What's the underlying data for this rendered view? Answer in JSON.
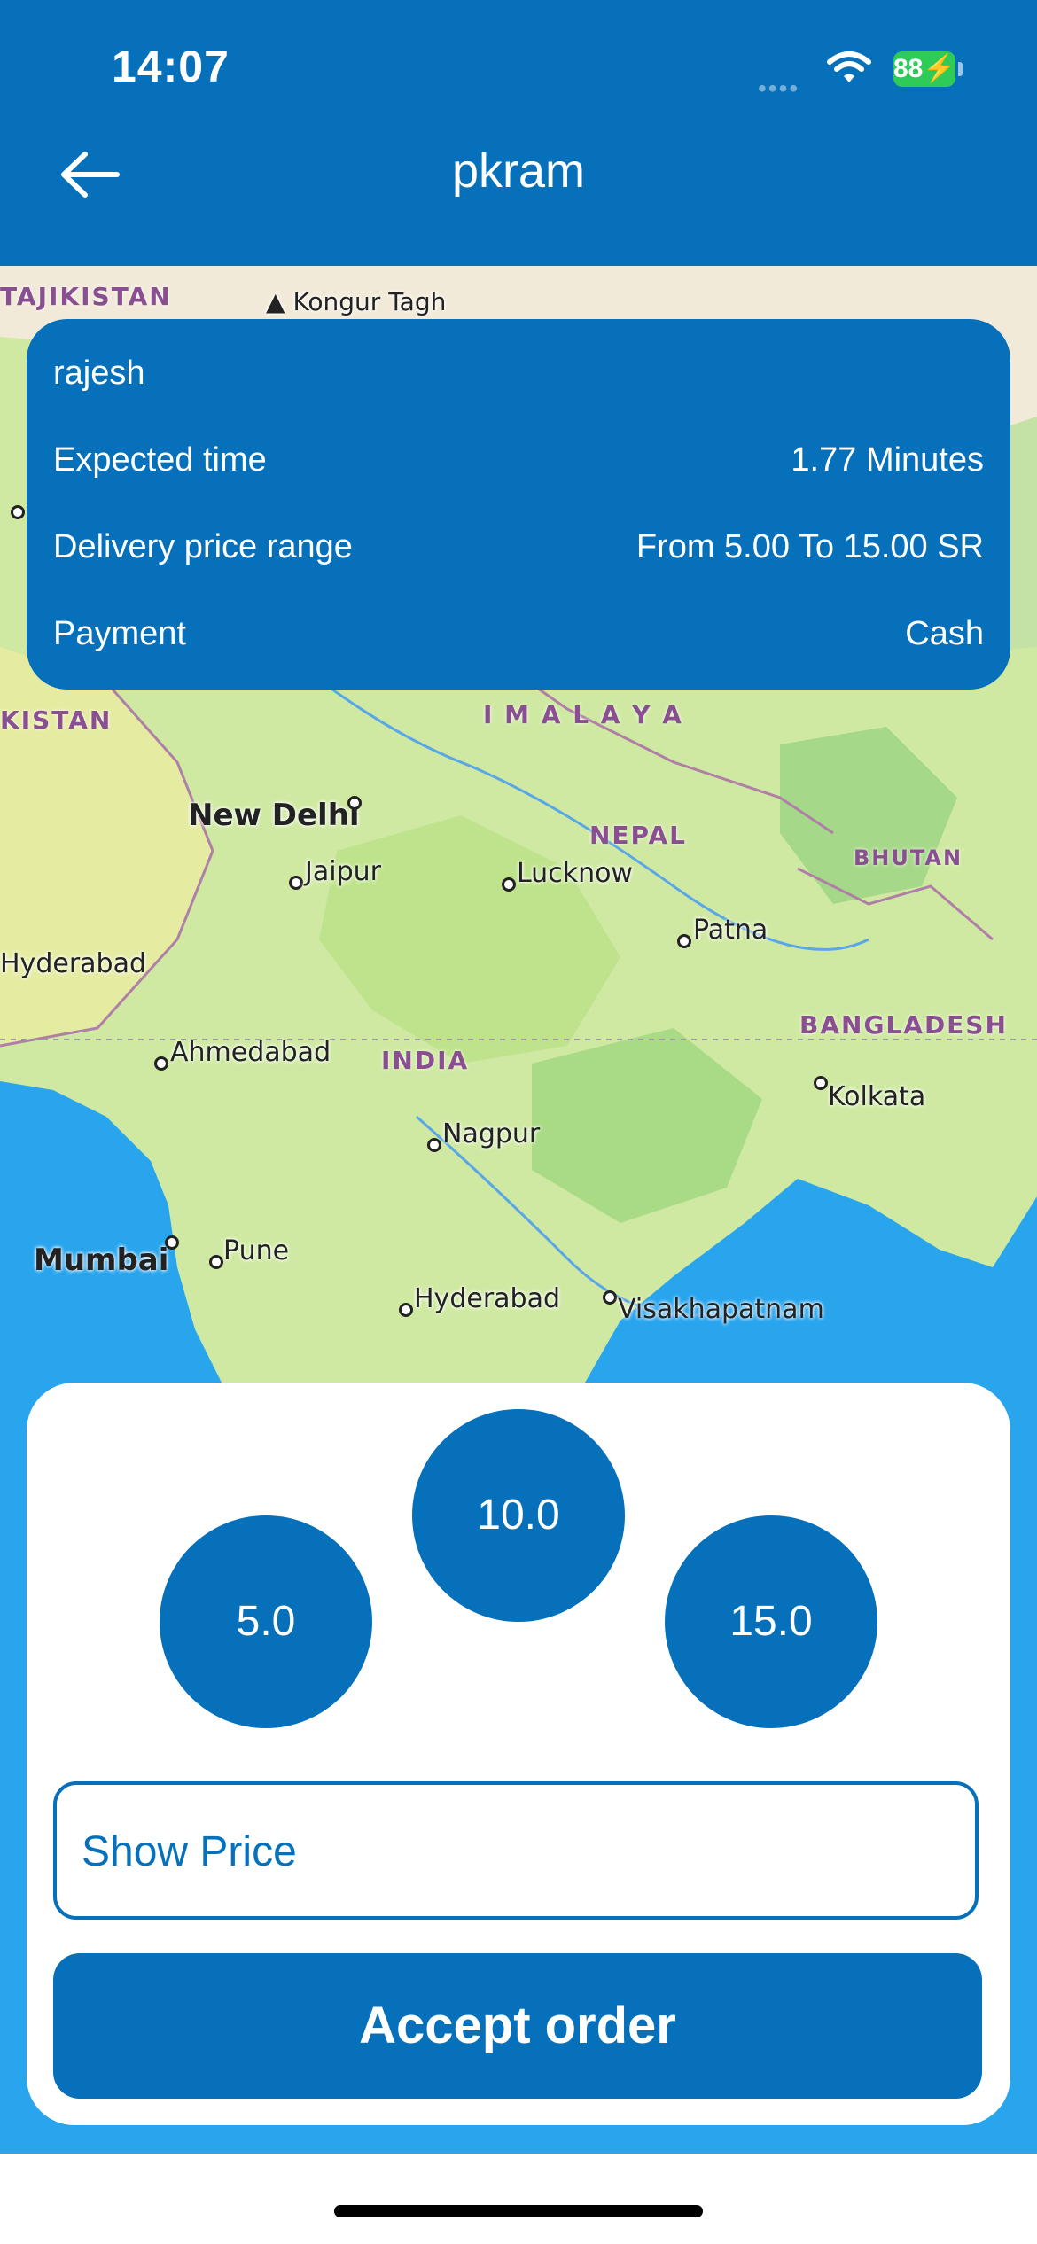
{
  "status_bar": {
    "time": "14:07",
    "battery": "88"
  },
  "nav": {
    "title": "pkram"
  },
  "map": {
    "countries": [
      "TAJIKISTAN",
      "KISTAN",
      "NEPAL",
      "BHUTAN",
      "BANGLADESH",
      "INDIA",
      "I M A L A Y A"
    ],
    "peaks": [
      "Kongur Tagh"
    ],
    "cities": [
      "New Delhi",
      "Jaipur",
      "Lucknow",
      "Patna",
      "Hyderabad",
      "Ahmedabad",
      "Kolkata",
      "Nagpur",
      "Mumbai",
      "Pune",
      "Hyderabad",
      "Visakhapatnam"
    ]
  },
  "order": {
    "customer": "rajesh",
    "expected_time_label": "Expected time",
    "expected_time_value": "1.77 Minutes",
    "price_range_label": "Delivery price range",
    "price_range_value": "From 5.00 To 15.00 SR",
    "payment_label": "Payment",
    "payment_value": "Cash"
  },
  "price_options": [
    "5.0",
    "10.0",
    "15.0"
  ],
  "show_price": {
    "placeholder": "Show Price"
  },
  "accept_button": {
    "label": "Accept order"
  },
  "colors": {
    "primary": "#0670BB",
    "battery": "#2fcb58"
  },
  "icons": [
    "back-arrow-icon",
    "wifi-icon",
    "battery-icon",
    "cellular-signal-icon"
  ]
}
